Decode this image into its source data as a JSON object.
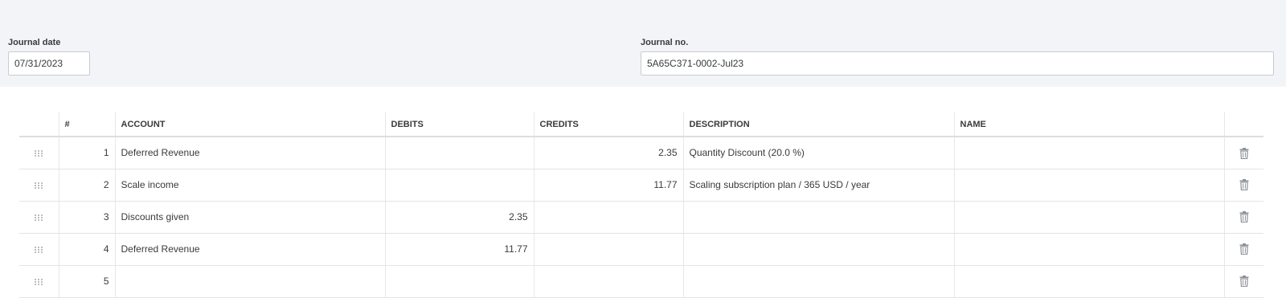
{
  "form": {
    "journal_date_label": "Journal date",
    "journal_date_value": "07/31/2023",
    "journal_no_label": "Journal no.",
    "journal_no_value": "5A65C371-0002-Jul23"
  },
  "table": {
    "headers": {
      "index": "#",
      "account": "ACCOUNT",
      "debits": "DEBITS",
      "credits": "CREDITS",
      "description": "DESCRIPTION",
      "name": "NAME"
    },
    "rows": [
      {
        "index": "1",
        "account": "Deferred Revenue",
        "debits": "",
        "credits": "2.35",
        "description": "Quantity Discount (20.0 %)",
        "name": ""
      },
      {
        "index": "2",
        "account": "Scale income",
        "debits": "",
        "credits": "11.77",
        "description": "Scaling subscription plan / 365 USD / year",
        "name": ""
      },
      {
        "index": "3",
        "account": "Discounts given",
        "debits": "2.35",
        "credits": "",
        "description": "",
        "name": ""
      },
      {
        "index": "4",
        "account": "Deferred Revenue",
        "debits": "11.77",
        "credits": "",
        "description": "",
        "name": ""
      },
      {
        "index": "5",
        "account": "",
        "debits": "",
        "credits": "",
        "description": "",
        "name": ""
      }
    ]
  },
  "icons": {
    "drag_handle": "drag-handle-icon",
    "delete": "trash-icon"
  },
  "colors": {
    "header_band": "#f3f4f7",
    "text": "#393a3d",
    "icon": "#8d9096"
  }
}
